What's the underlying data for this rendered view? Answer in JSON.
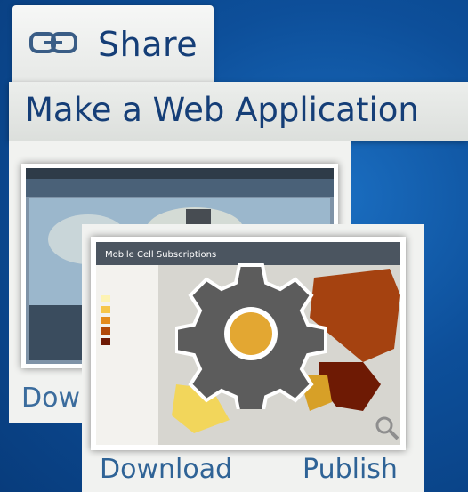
{
  "share": {
    "label": "Share",
    "icon": "link-icon"
  },
  "menu": {
    "title": "Make a Web Application"
  },
  "back_card": {
    "download_label": "Dow"
  },
  "front_card": {
    "download_label": "Download",
    "publish_label": "Publish",
    "thumb_title": "Mobile Cell Subscriptions",
    "config_icon": "gear-icon",
    "zoom_icon": "magnifier-icon"
  },
  "colors": {
    "accent": "#153e77",
    "link": "#2f6396",
    "background": "#0d4f9a"
  }
}
